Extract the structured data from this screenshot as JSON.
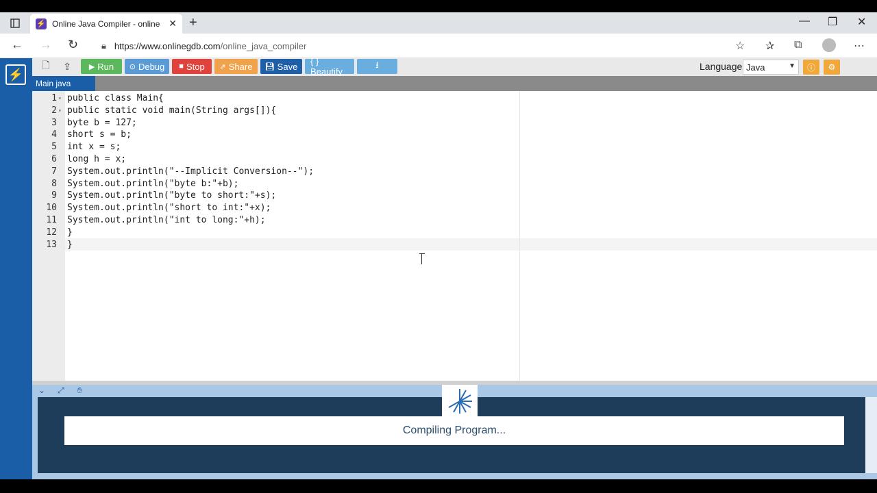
{
  "browser": {
    "tab_title": "Online Java Compiler - online ec",
    "url_host": "https://www.onlinegdb.com",
    "url_path": "/online_java_compiler"
  },
  "toolbar": {
    "run_label": "Run",
    "debug_label": "Debug",
    "stop_label": "Stop",
    "share_label": "Share",
    "save_label": "Save",
    "beautify_label": "{ } Beautify",
    "language_label": "Language",
    "language_value": "Java"
  },
  "file_tab": "Main java",
  "editor": {
    "lines": [
      {
        "n": "1",
        "code": "public class Main{"
      },
      {
        "n": "2",
        "code": "public static void main(String args[]){"
      },
      {
        "n": "3",
        "code": "byte b = 127;"
      },
      {
        "n": "4",
        "code": "short s = b;"
      },
      {
        "n": "5",
        "code": "int x = s;"
      },
      {
        "n": "6",
        "code": "long h = x;"
      },
      {
        "n": "7",
        "code": "System.out.println(\"--Implicit Conversion--\");"
      },
      {
        "n": "8",
        "code": "System.out.println(\"byte b:\"+b);"
      },
      {
        "n": "9",
        "code": "System.out.println(\"byte to short:\"+s);"
      },
      {
        "n": "10",
        "code": "System.out.println(\"short to int:\"+x);"
      },
      {
        "n": "11",
        "code": "System.out.println(\"int to long:\"+h);"
      },
      {
        "n": "12",
        "code": "}"
      },
      {
        "n": "13",
        "code": "}"
      }
    ]
  },
  "output": {
    "message": "Compiling Program..."
  },
  "colors": {
    "run": "#5cb85c",
    "debug": "#5b9bd5",
    "stop": "#e0433e",
    "share": "#f0a34a",
    "save": "#1f5fa8",
    "beautify": "#6aaee0",
    "download": "#6aaee0",
    "rail": "#1a5ea8"
  }
}
